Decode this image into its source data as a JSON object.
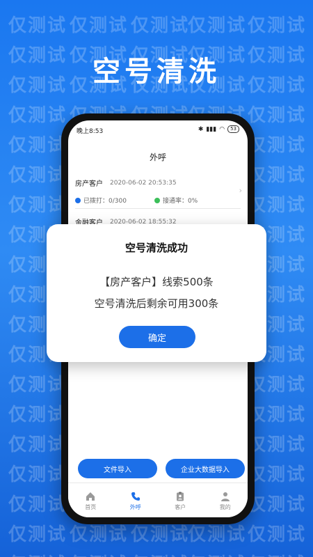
{
  "headline": "空号清洗",
  "watermark_text": "仅测试",
  "status_bar": {
    "time": "晚上8:53",
    "battery": "53"
  },
  "screen_title": "外呼",
  "records": [
    {
      "name": "房产客户",
      "date": "2020-06-02 20:53:35",
      "dialed": "已拨打：0/300",
      "connect_rate": "接通率：0%"
    },
    {
      "name": "金融客户",
      "date": "2020-06-02 18:55:32"
    }
  ],
  "buttons": {
    "file_import": "文件导入",
    "bigdata_import": "企业大数据导入"
  },
  "tabs": [
    {
      "label": "首页",
      "icon": "home-icon"
    },
    {
      "label": "外呼",
      "icon": "phone-icon"
    },
    {
      "label": "客户",
      "icon": "clipboard-user-icon"
    },
    {
      "label": "我的",
      "icon": "person-icon"
    }
  ],
  "modal": {
    "title": "空号清洗成功",
    "line1": "【房产客户】线索500条",
    "line2": "空号清洗后剩余可用300条",
    "confirm": "确定"
  },
  "colors": {
    "accent": "#1c6fe8",
    "background": "#1a77f0"
  }
}
